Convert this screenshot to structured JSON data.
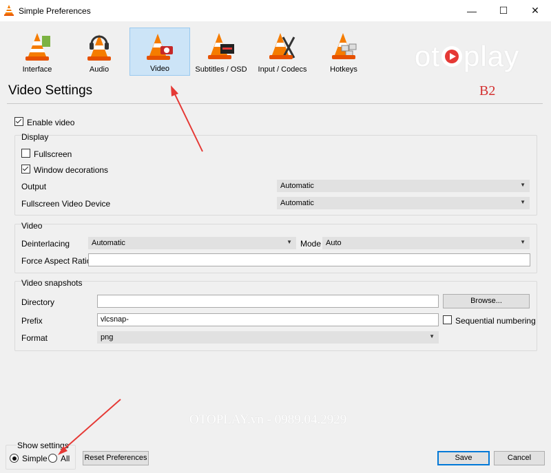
{
  "window": {
    "title": "Simple Preferences",
    "minimize": "—",
    "maximize": "☐",
    "close": "✕"
  },
  "toolbar": {
    "items": [
      {
        "label": "Interface"
      },
      {
        "label": "Audio"
      },
      {
        "label": "Video",
        "selected": true
      },
      {
        "label": "Subtitles / OSD"
      },
      {
        "label": "Input / Codecs"
      },
      {
        "label": "Hotkeys"
      }
    ]
  },
  "watermark": {
    "text_before": "ot",
    "text_after": "play"
  },
  "heading": "Video Settings",
  "annotation": "B2",
  "enable_video": {
    "label": "Enable video",
    "checked": true
  },
  "display": {
    "title": "Display",
    "fullscreen": {
      "label": "Fullscreen",
      "checked": false
    },
    "window_decorations": {
      "label": "Window decorations",
      "checked": true
    },
    "output": {
      "label": "Output",
      "value": "Automatic"
    },
    "fullscreen_device": {
      "label": "Fullscreen Video Device",
      "value": "Automatic"
    }
  },
  "video": {
    "title": "Video",
    "deinterlacing": {
      "label": "Deinterlacing",
      "value": "Automatic"
    },
    "mode": {
      "label": "Mode",
      "value": "Auto"
    },
    "aspect": {
      "label": "Force Aspect Ratio",
      "value": ""
    }
  },
  "snapshots": {
    "title": "Video snapshots",
    "directory": {
      "label": "Directory",
      "value": ""
    },
    "browse": "Browse...",
    "prefix": {
      "label": "Prefix",
      "value": "vlcsnap-"
    },
    "sequential": {
      "label": "Sequential numbering",
      "checked": false
    },
    "format": {
      "label": "Format",
      "value": "png"
    }
  },
  "footer_watermark": "OTOPLAY.vn - 0989.04.2929",
  "show_settings": {
    "title": "Show settings",
    "simple": "Simple",
    "all": "All",
    "selected": "Simple"
  },
  "buttons": {
    "reset": "Reset Preferences",
    "save": "Save",
    "cancel": "Cancel"
  }
}
